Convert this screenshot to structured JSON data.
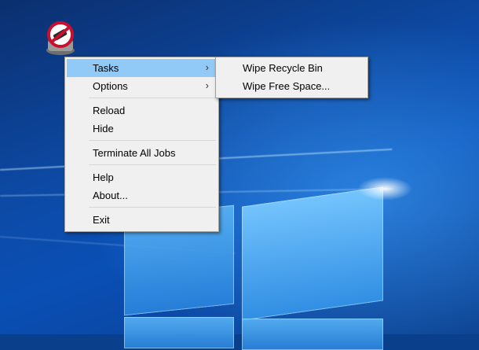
{
  "desktop": {
    "wallpaper": "Windows 10 hero",
    "accent": "#0a4fb5"
  },
  "tray_icon": {
    "name": "eraser-icon",
    "colors": {
      "ring": "#c8102e",
      "body": "#7a7a7a"
    }
  },
  "context_menu": {
    "items": [
      {
        "label": "Tasks",
        "has_submenu": true,
        "highlighted": true
      },
      {
        "label": "Options",
        "has_submenu": true
      },
      {
        "label": "Reload"
      },
      {
        "label": "Hide"
      },
      {
        "label": "Terminate All Jobs"
      },
      {
        "label": "Help"
      },
      {
        "label": "About..."
      },
      {
        "label": "Exit"
      }
    ],
    "submenu_arrow": "›",
    "highlight_color": "#91c9f7",
    "background": "#f0f0f0"
  },
  "tasks_submenu": {
    "items": [
      {
        "label": "Wipe Recycle Bin"
      },
      {
        "label": "Wipe Free Space..."
      }
    ]
  }
}
